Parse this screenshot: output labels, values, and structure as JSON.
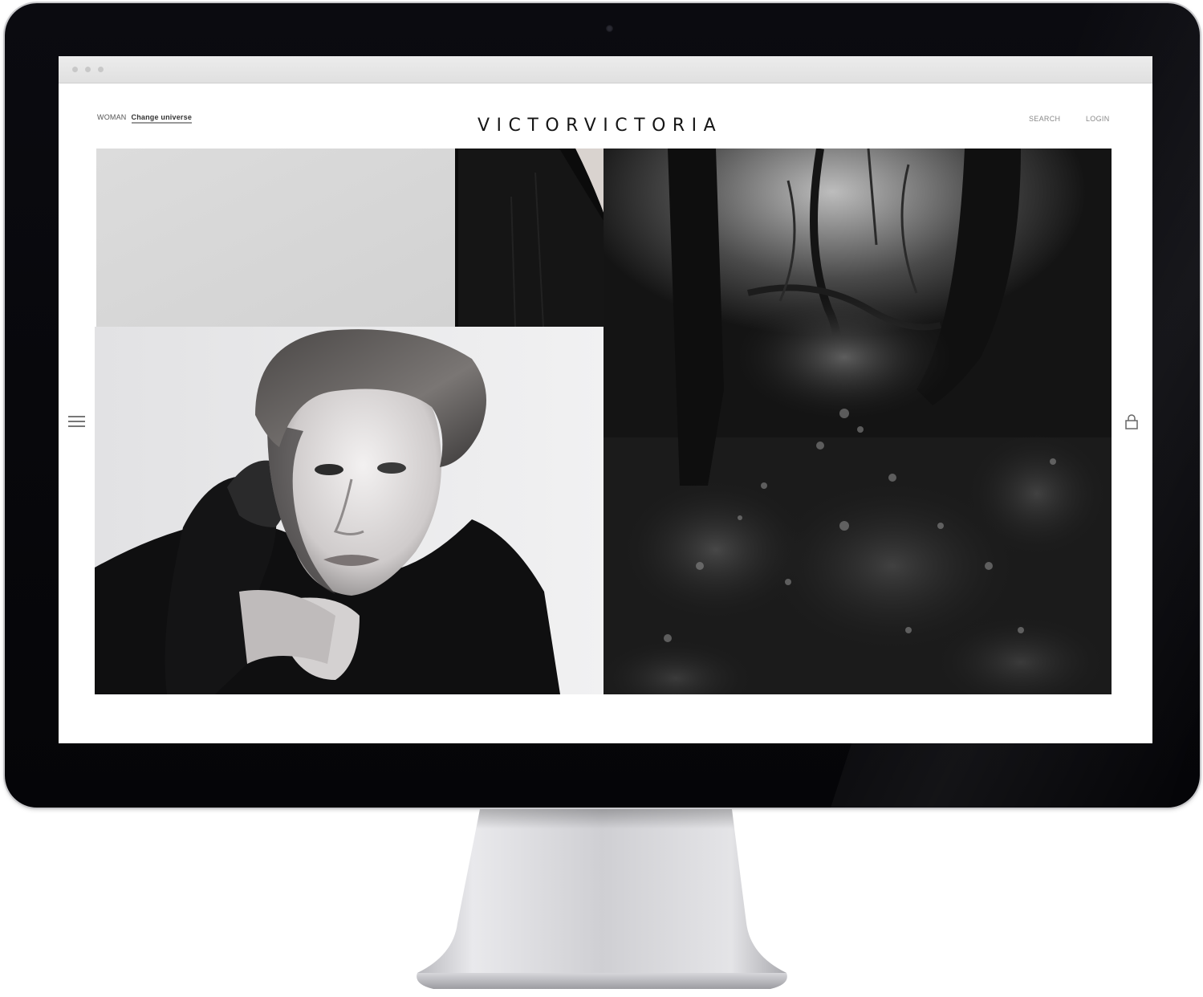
{
  "header": {
    "universe_label": "WOMAN",
    "change_universe": "Change universe",
    "logo": "VICTORVICTORIA",
    "search": "SEARCH",
    "login": "LOGIN"
  },
  "icons": {
    "menu": "hamburger-menu-icon",
    "bag": "shopping-bag-icon"
  },
  "tiles": [
    {
      "name": "product-tile-grey",
      "description_color": "#d8d8d8"
    },
    {
      "name": "product-tile-black-garment",
      "description_color": "#141414"
    },
    {
      "name": "portrait-model-photo",
      "description_color": "#e9e9ea"
    },
    {
      "name": "forest-photo",
      "description_color": "#1c1c1c"
    }
  ],
  "colors": {
    "bezel": "#0b0b10",
    "screen_bg": "#ffffff",
    "text": "#151515",
    "muted": "#888888"
  }
}
